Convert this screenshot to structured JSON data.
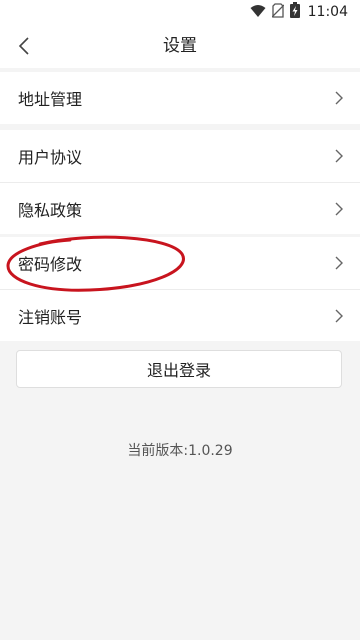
{
  "status_bar": {
    "time": "11:04",
    "icons": [
      "wifi-icon",
      "no-sim-icon",
      "battery-charging-icon"
    ]
  },
  "nav": {
    "title": "设置",
    "back_icon": "chevron-left-icon"
  },
  "groups": [
    {
      "items": [
        {
          "label": "地址管理"
        }
      ]
    },
    {
      "items": [
        {
          "label": "用户协议"
        },
        {
          "label": "隐私政策"
        }
      ]
    },
    {
      "items": [
        {
          "label": "密码修改",
          "highlighted": true
        },
        {
          "label": "注销账号"
        }
      ]
    }
  ],
  "logout": {
    "label": "退出登录"
  },
  "version": {
    "text": "当前版本:1.0.29"
  },
  "colors": {
    "annotation_circle": "#c8141e",
    "background": "#f4f4f4",
    "chevron": "#666666"
  }
}
